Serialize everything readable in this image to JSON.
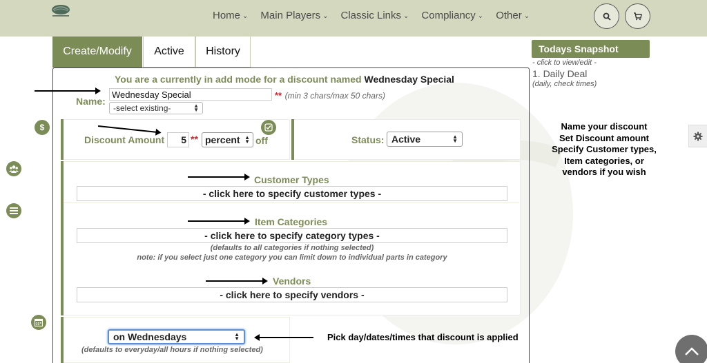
{
  "nav": {
    "items": [
      "Home",
      "Main Players",
      "Classic Links",
      "Compliancy",
      "Other"
    ],
    "search_icon": "search-icon",
    "cart_icon": "cart-icon"
  },
  "tabs": [
    "Create/Modify",
    "Active",
    "History"
  ],
  "form": {
    "heading_prefix": "You are a currently in add mode for a discount named",
    "discount_name": "Wednesday Special",
    "name_label": "Name:",
    "name_value": "Wednesday Special",
    "required_mark": "**",
    "name_hint": "(min 3 chars/max 50 chars)",
    "select_existing": "-select existing-",
    "amount_label": "Discount Amount",
    "amount_value": "5",
    "amount_unit": "percent",
    "amount_suffix": "off",
    "status_label": "Status:",
    "status_value": "Active",
    "customer_types_label": "Customer Types",
    "customer_types_button": "- click here to specify customer types -",
    "item_categories_label": "Item Categories",
    "item_categories_button": "- click here to specify category types -",
    "categories_note1": "(defaults to all categories if nothing selected)",
    "categories_note2": "note: if you select just one category you can limit down to individual parts in category",
    "vendors_label": "Vendors",
    "vendors_button": "- click here to specify vendors -",
    "day_select": "on Wednesdays",
    "day_note": "(defaults to everyday/all hours if nothing selected)"
  },
  "sidebar": {
    "snapshot_button": "Todays Snapshot",
    "snapshot_sub": "- click to view/edit -",
    "snapshot_item": "1. Daily Deal",
    "snapshot_item_note": "(daily, check times)"
  },
  "annotations": {
    "help_lines": [
      "Name your discount",
      "Set Discount amount",
      "Specify Customer types,",
      "Item categories, or",
      "vendors if you wish"
    ],
    "pick_text": "Pick day/dates/times that discount is applied"
  },
  "colors": {
    "olive": "#7c8c57",
    "topbar": "#d4d8bf",
    "required": "#d2222a"
  }
}
